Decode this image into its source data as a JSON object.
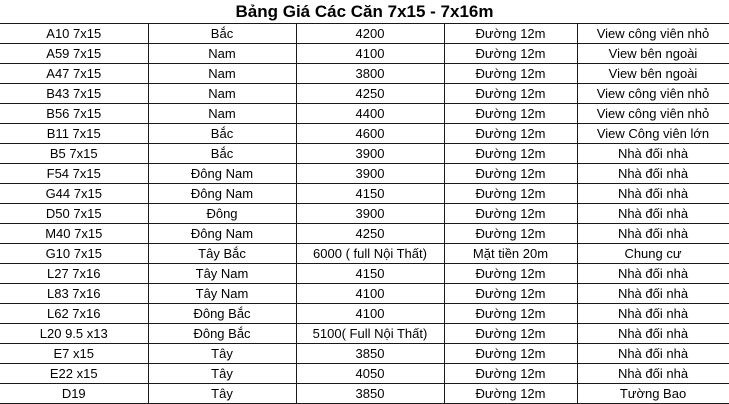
{
  "title": "Bảng Giá Các Căn 7x15 - 7x16m",
  "rows": [
    {
      "code": "A10 7x15",
      "direction": "Bắc",
      "price": "4200",
      "road": "Đường 12m",
      "view": "View công viên nhỏ"
    },
    {
      "code": "A59 7x15",
      "direction": "Nam",
      "price": "4100",
      "road": "Đường 12m",
      "view": "View bên ngoài"
    },
    {
      "code": "A47 7x15",
      "direction": "Nam",
      "price": "3800",
      "road": "Đường 12m",
      "view": "View bên ngoài"
    },
    {
      "code": "B43 7x15",
      "direction": "Nam",
      "price": "4250",
      "road": "Đường 12m",
      "view": "View công viên nhỏ"
    },
    {
      "code": "B56 7x15",
      "direction": "Nam",
      "price": "4400",
      "road": "Đường 12m",
      "view": "View công viên nhỏ"
    },
    {
      "code": "B11 7x15",
      "direction": "Bắc",
      "price": "4600",
      "road": "Đường 12m",
      "view": "View Công viên lớn"
    },
    {
      "code": "B5 7x15",
      "direction": "Bắc",
      "price": "3900",
      "road": "Đường 12m",
      "view": "Nhà đối nhà"
    },
    {
      "code": "F54 7x15",
      "direction": "Đông Nam",
      "price": "3900",
      "road": "Đường 12m",
      "view": "Nhà đối nhà"
    },
    {
      "code": "G44 7x15",
      "direction": "Đông Nam",
      "price": "4150",
      "road": "Đường 12m",
      "view": "Nhà đối nhà"
    },
    {
      "code": "D50 7x15",
      "direction": "Đông",
      "price": "3900",
      "road": "Đường 12m",
      "view": "Nhà đối nhà"
    },
    {
      "code": "M40 7x15",
      "direction": "Đông Nam",
      "price": "4250",
      "road": "Đường 12m",
      "view": "Nhà đối nhà"
    },
    {
      "code": "G10 7x15",
      "direction": "Tây Bắc",
      "price": "6000 ( full Nội Thất)",
      "road": "Mặt tiền 20m",
      "view": "Chung cư"
    },
    {
      "code": "L27 7x16",
      "direction": "Tây Nam",
      "price": "4150",
      "road": "Đường 12m",
      "view": "Nhà đối nhà"
    },
    {
      "code": "L83 7x16",
      "direction": "Tây Nam",
      "price": "4100",
      "road": "Đường 12m",
      "view": "Nhà đối nhà"
    },
    {
      "code": "L62 7x16",
      "direction": "Đông Bắc",
      "price": "4100",
      "road": "Đường 12m",
      "view": "Nhà đối nhà"
    },
    {
      "code": "L20 9.5 x13",
      "direction": "Đông Bắc",
      "price": "5100( Full Nội Thất)",
      "road": "Đường 12m",
      "view": "Nhà đối nhà"
    },
    {
      "code": "E7 x15",
      "direction": "Tây",
      "price": "3850",
      "road": "Đường 12m",
      "view": "Nhà đối nhà"
    },
    {
      "code": "E22 x15",
      "direction": "Tây",
      "price": "4050",
      "road": "Đường 12m",
      "view": "Nhà đối nhà"
    },
    {
      "code": "D19",
      "direction": "Tây",
      "price": "3850",
      "road": "Đường 12m",
      "view": "Tường Bao"
    }
  ]
}
